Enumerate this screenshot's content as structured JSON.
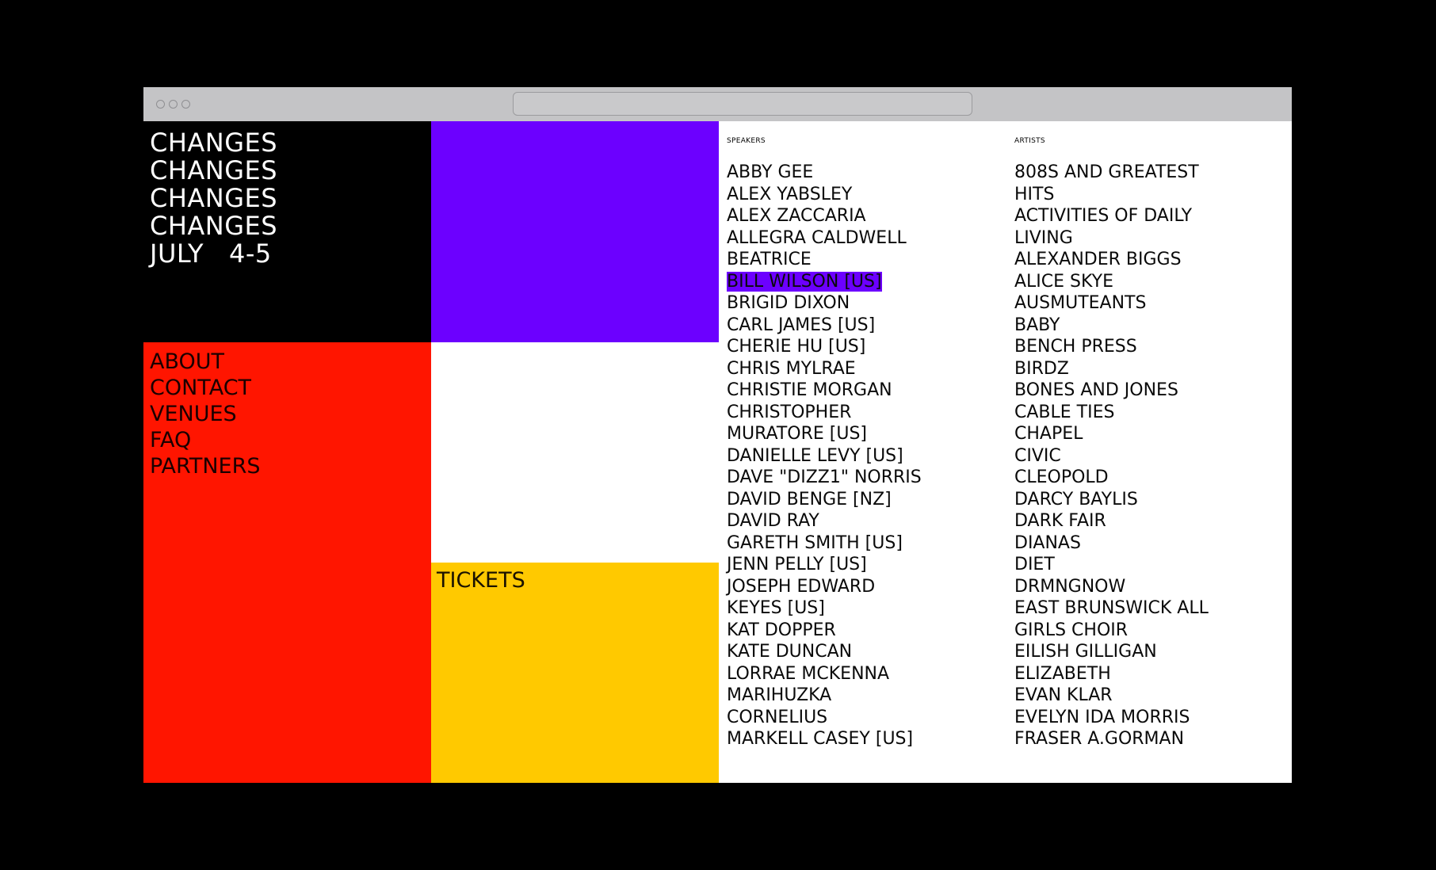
{
  "logo": {
    "lines": [
      "CHANGES",
      "CHANGES",
      "CHANGES",
      "CHANGES",
      "JULY   4-5"
    ]
  },
  "nav": {
    "items": [
      "ABOUT",
      "CONTACT",
      "VENUES",
      "FAQ",
      "PARTNERS"
    ]
  },
  "tickets_label": "TICKETS",
  "speakers": {
    "heading": "SPEAKERS",
    "items": [
      "ABBY GEE",
      "ALEX YABSLEY",
      "ALEX ZACCARIA",
      "ALLEGRA CALDWELL",
      "BEATRICE",
      "BILL WILSON [US]",
      "BRIGID DIXON",
      "CARL JAMES [US]",
      "CHERIE HU [US]",
      "CHRIS MYLRAE",
      "CHRISTIE MORGAN",
      "CHRISTOPHER",
      "MURATORE [US]",
      "DANIELLE LEVY [US]",
      "DAVE \"DIZZ1\" NORRIS",
      "DAVID BENGE [NZ]",
      "DAVID RAY",
      "GARETH SMITH [US]",
      "JENN PELLY [US]",
      "JOSEPH EDWARD",
      "KEYES [US]",
      "KAT DOPPER",
      "KATE DUNCAN",
      "LORRAE MCKENNA",
      "MARIHUZKA",
      "CORNELIUS",
      "MARKELL CASEY [US]"
    ],
    "highlighted": "BILL WILSON [US]"
  },
  "artists": {
    "heading": "ARTISTS",
    "items": [
      "808S AND GREATEST",
      "HITS",
      "ACTIVITIES OF DAILY",
      "LIVING",
      "ALEXANDER BIGGS",
      "ALICE SKYE",
      "AUSMUTEANTS",
      "BABY",
      "BENCH PRESS",
      "BIRDZ",
      "BONES AND JONES",
      "CABLE TIES",
      "CHAPEL",
      "CIVIC",
      "CLEOPOLD",
      "DARCY BAYLIS",
      "DARK FAIR",
      "DIANAS",
      "DIET",
      "DRMNGNOW",
      "EAST BRUNSWICK ALL",
      "GIRLS CHOIR",
      "EILISH GILLIGAN",
      "ELIZABETH",
      "EVAN KLAR",
      "EVELYN IDA MORRIS",
      "FRASER A.GORMAN"
    ]
  },
  "colors": {
    "purple": "#6c00ff",
    "red": "#ff1500",
    "yellow": "#ffc900",
    "black": "#000000",
    "white": "#ffffff"
  }
}
